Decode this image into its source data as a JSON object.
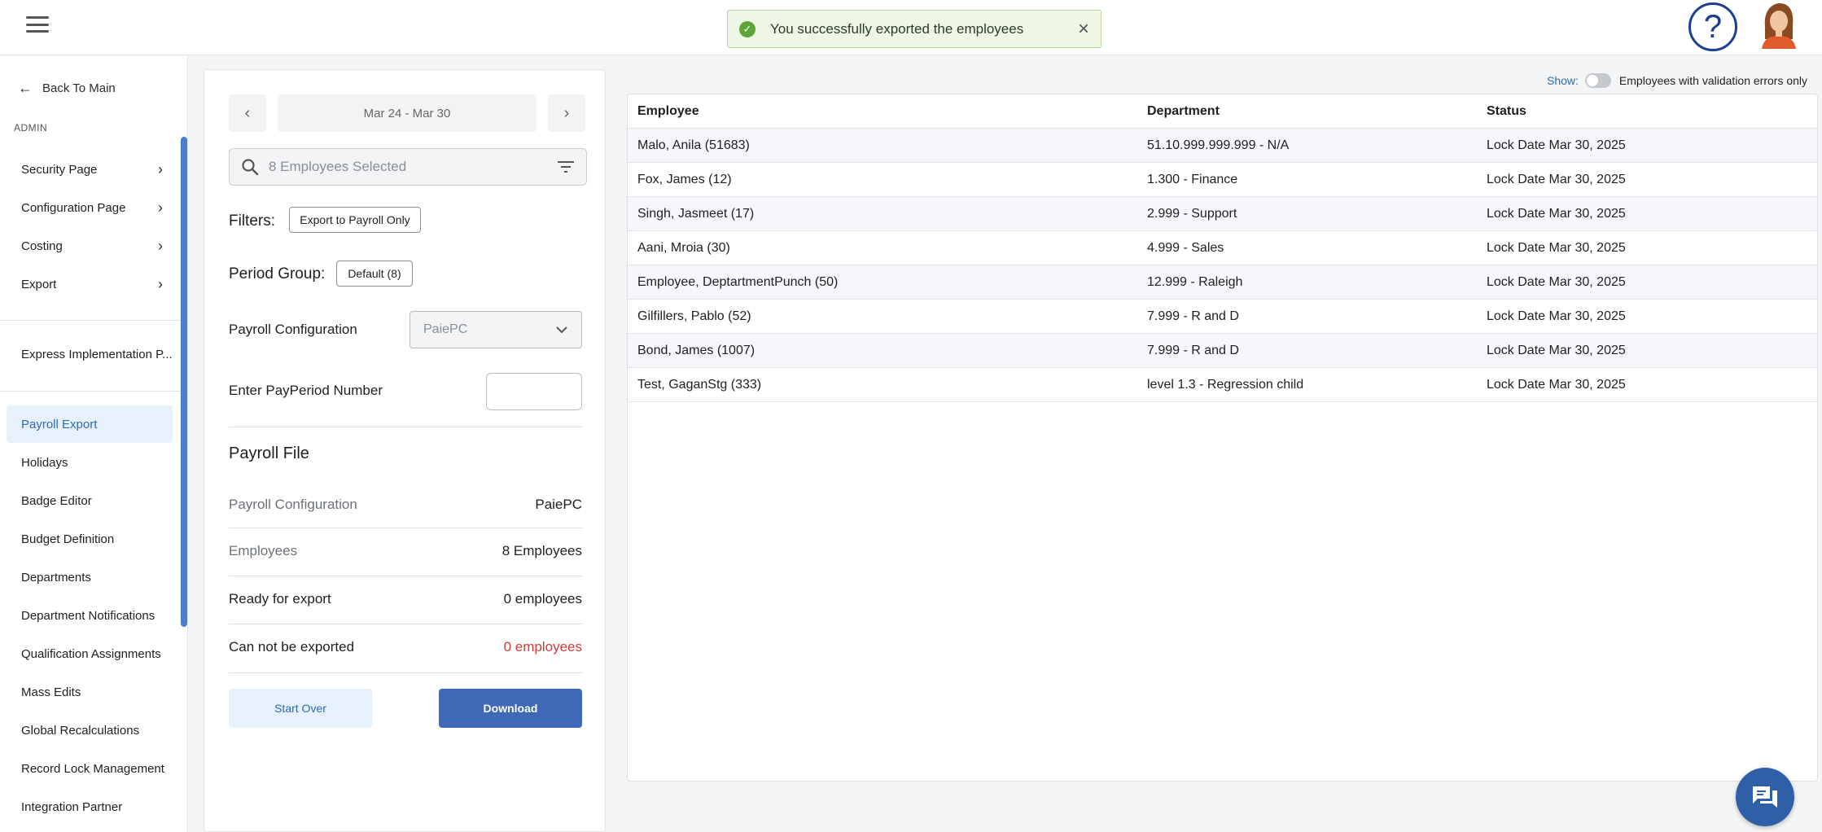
{
  "toast": {
    "message": "You successfully exported the employees"
  },
  "sidebar": {
    "back_label": "Back To Main",
    "section_label": "ADMIN",
    "groups": [
      {
        "label": "Security Page"
      },
      {
        "label": "Configuration Page"
      },
      {
        "label": "Costing"
      },
      {
        "label": "Export"
      }
    ],
    "express": "Express Implementation P...",
    "items": [
      {
        "label": "Payroll Export",
        "active": true
      },
      {
        "label": "Holidays"
      },
      {
        "label": "Badge Editor"
      },
      {
        "label": "Budget Definition"
      },
      {
        "label": "Departments"
      },
      {
        "label": "Department Notifications"
      },
      {
        "label": "Qualification Assignments"
      },
      {
        "label": "Mass Edits"
      },
      {
        "label": "Global Recalculations"
      },
      {
        "label": "Record Lock Management"
      },
      {
        "label": "Integration Partner"
      }
    ]
  },
  "panel": {
    "period_range": "Mar 24 - Mar 30",
    "employees_placeholder": "8 Employees Selected",
    "filters_label": "Filters:",
    "filters_chip": "Export to Payroll Only",
    "period_group_label": "Period Group:",
    "period_group_chip": "Default (8)",
    "payroll_config_label": "Payroll Configuration",
    "payroll_config_value": "PaiePC",
    "payperiod_label": "Enter PayPeriod Number",
    "payperiod_value": "",
    "file_title": "Payroll File",
    "file_rows": [
      {
        "key": "Payroll Configuration",
        "value": "PaiePC"
      },
      {
        "key": "Employees",
        "value": "8 Employees"
      },
      {
        "key": "Ready for export",
        "value": "0 employees"
      },
      {
        "key": "Can not be exported",
        "value": "0 employees"
      }
    ],
    "start_over": "Start Over",
    "download": "Download"
  },
  "table": {
    "show_label": "Show:",
    "toggle_label": "Employees with validation errors only",
    "columns": [
      "Employee",
      "Department",
      "Status"
    ],
    "rows": [
      [
        "Malo, Anila (51683)",
        "51.10.999.999.999 - N/A",
        "Lock Date Mar 30, 2025"
      ],
      [
        "Fox, James (12)",
        "1.300 - Finance",
        "Lock Date Mar 30, 2025"
      ],
      [
        "Singh, Jasmeet (17)",
        "2.999 - Support",
        "Lock Date Mar 30, 2025"
      ],
      [
        "Aani, Mroia (30)",
        "4.999 - Sales",
        "Lock Date Mar 30, 2025"
      ],
      [
        "Employee, DeptartmentPunch (50)",
        "12.999 - Raleigh",
        "Lock Date Mar 30, 2025"
      ],
      [
        "Gilfillers, Pablo (52)",
        "7.999 - R and D",
        "Lock Date Mar 30, 2025"
      ],
      [
        "Bond, James (1007)",
        "7.999 - R and D",
        "Lock Date Mar 30, 2025"
      ],
      [
        "Test, GaganStg (333)",
        "level 1.3 - Regression child",
        "Lock Date Mar 30, 2025"
      ]
    ]
  },
  "colors": {
    "accent": "#3f69b6",
    "active_bg": "#e6f1fb",
    "error": "#d23b3b",
    "success": "#5fa536"
  },
  "icons": [
    "menu-icon",
    "check-circle-icon",
    "close-icon",
    "help-icon",
    "avatar",
    "arrow-left-icon",
    "chevron-right-icon",
    "chevron-left-icon",
    "search-icon",
    "filter-icon",
    "chevron-down-icon",
    "chat-icon"
  ]
}
